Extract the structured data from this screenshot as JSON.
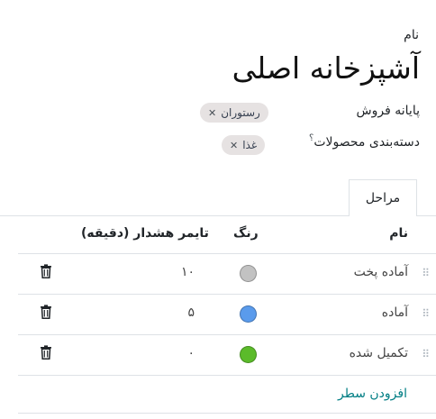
{
  "form": {
    "name_label": "نام",
    "title": "آشپزخانه اصلی",
    "pos_label": "پایانه فروش",
    "pos_tag": "رستوران",
    "category_label": "دسته‌بندی محصولات",
    "category_help": "؟",
    "category_tag": "غذا"
  },
  "tabs": [
    {
      "label": "مراحل",
      "active": true
    }
  ],
  "table": {
    "headers": {
      "name": "نام",
      "color": "رنگ",
      "timer": "تایمر هشدار (دقیقه)"
    },
    "rows": [
      {
        "name": "آماده پخت",
        "color": "#c2c2c2",
        "timer": "۱۰"
      },
      {
        "name": "آماده",
        "color": "#5a9bec",
        "timer": "۵"
      },
      {
        "name": "تکمیل شده",
        "color": "#5bbb2a",
        "timer": "۰"
      }
    ],
    "add_line": "افزودن سطر"
  },
  "icons": {
    "remove_tag": "close-icon",
    "drag": "drag-handle-icon",
    "delete": "trash-icon"
  },
  "colors": {
    "accent": "#017e84",
    "tag_bg": "#e6e2e2",
    "border": "#dee2e6"
  }
}
